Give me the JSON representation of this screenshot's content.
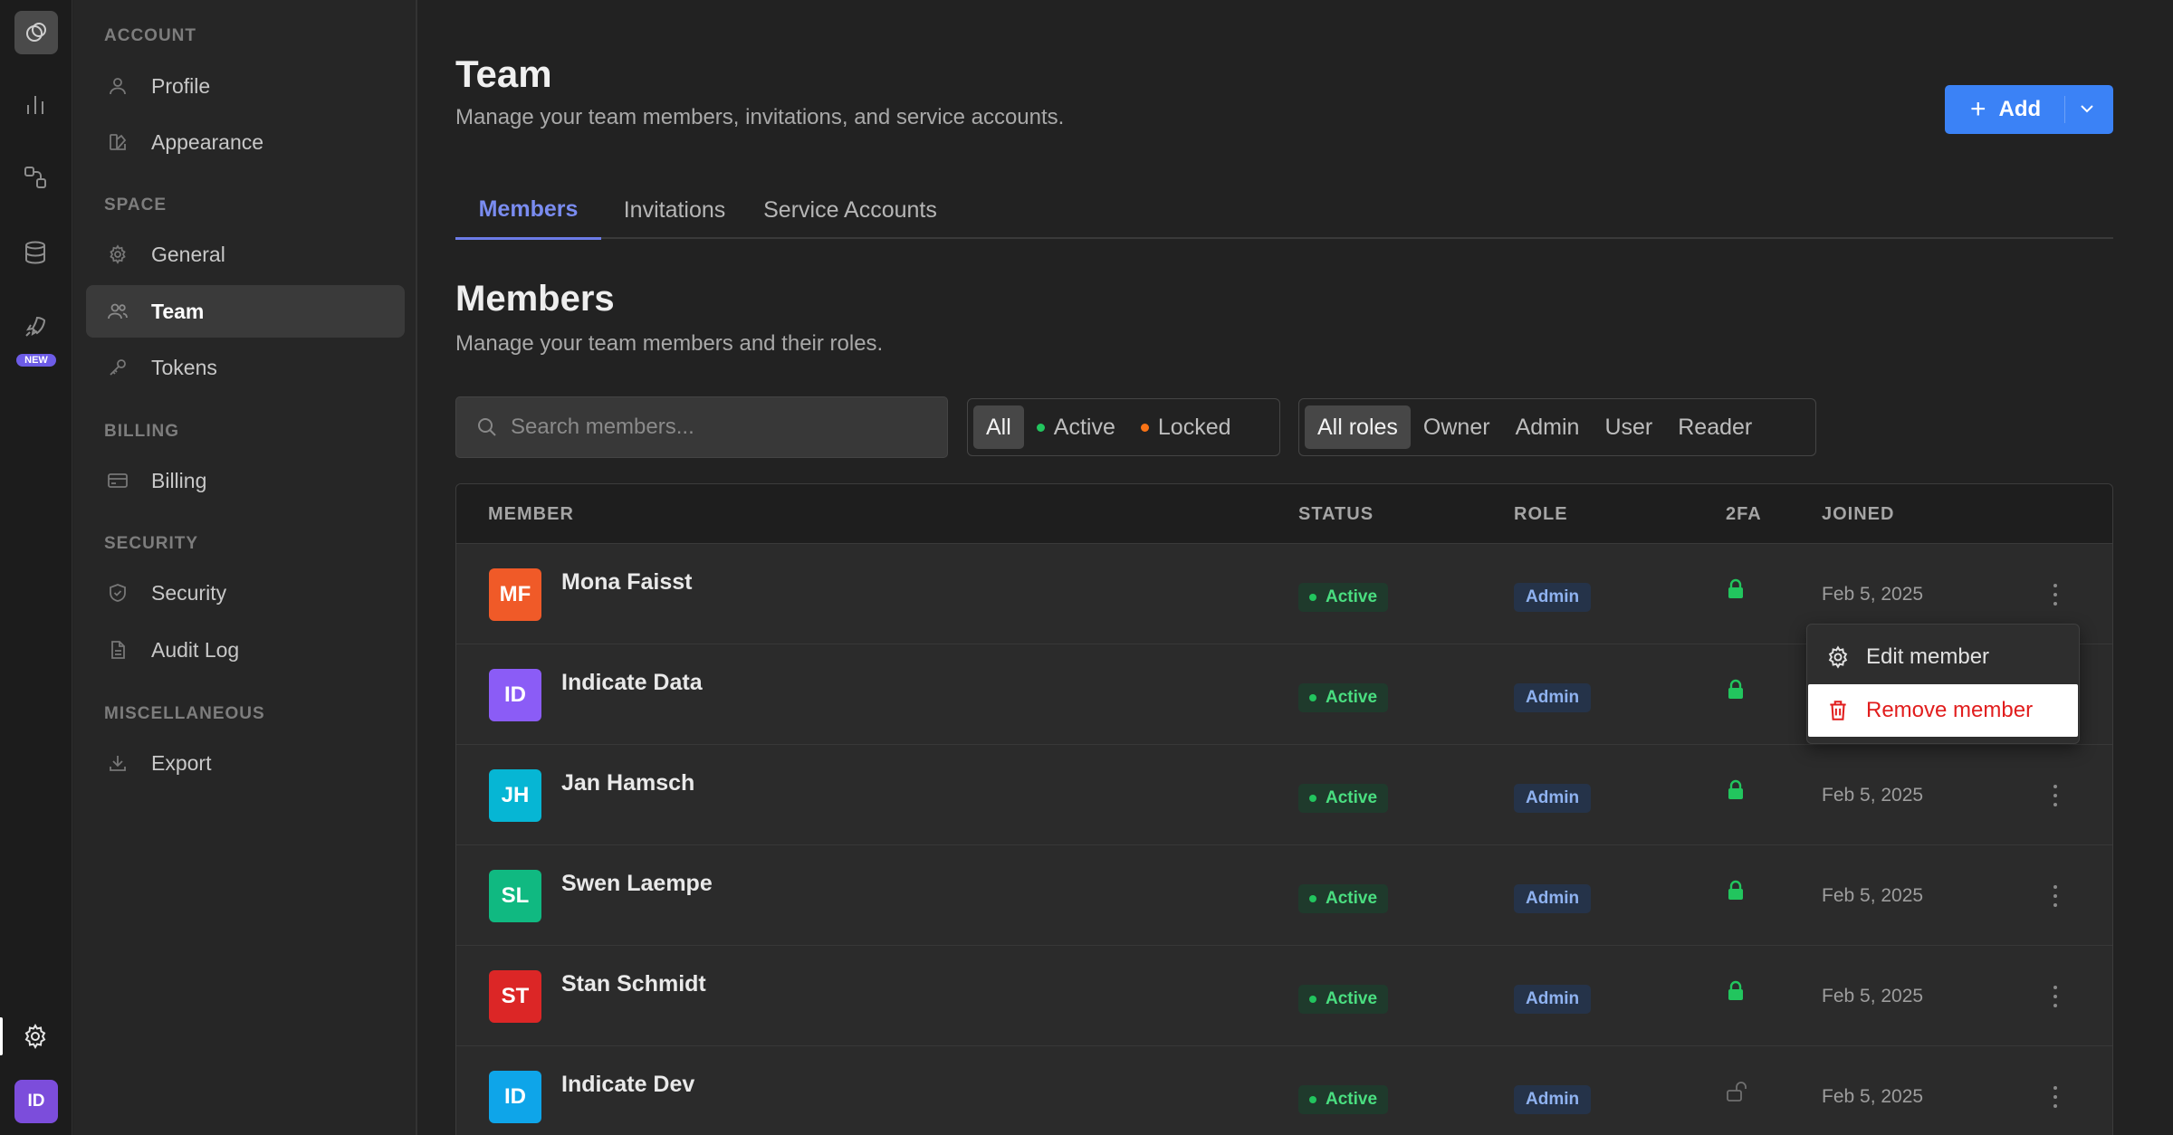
{
  "rail": {
    "new_badge": "NEW",
    "avatar": "ID",
    "icons": [
      "logo-icon",
      "analytics-icon",
      "integrations-icon",
      "database-icon",
      "rocket-icon",
      "settings-icon"
    ]
  },
  "sidebar": {
    "sections": [
      {
        "title": "ACCOUNT",
        "items": [
          "Profile",
          "Appearance"
        ]
      },
      {
        "title": "SPACE",
        "items": [
          "General",
          "Team",
          "Tokens"
        ]
      },
      {
        "title": "BILLING",
        "items": [
          "Billing"
        ]
      },
      {
        "title": "SECURITY",
        "items": [
          "Security",
          "Audit Log"
        ]
      },
      {
        "title": "MISCELLANEOUS",
        "items": [
          "Export"
        ]
      }
    ],
    "active_item": "Team"
  },
  "header": {
    "title": "Team",
    "subtitle": "Manage your team members, invitations, and service accounts.",
    "add_label": "Add"
  },
  "tabs": [
    "Members",
    "Invitations",
    "Service Accounts"
  ],
  "active_tab": "Members",
  "members_section": {
    "title": "Members",
    "subtitle": "Manage your team members and their roles.",
    "search_placeholder": "Search members...",
    "status_filters": [
      "All",
      "Active",
      "Locked"
    ],
    "role_filters": [
      "All roles",
      "Owner",
      "Admin",
      "User",
      "Reader"
    ]
  },
  "table": {
    "columns": [
      "MEMBER",
      "STATUS",
      "ROLE",
      "2FA",
      "JOINED"
    ],
    "rows": [
      {
        "initials": "MF",
        "name": "Mona Faisst",
        "status": "Active",
        "role": "Admin",
        "twofa": true,
        "joined": "Feb 5, 2025",
        "color": "#f05a28"
      },
      {
        "initials": "ID",
        "name": "Indicate Data",
        "status": "Active",
        "role": "Admin",
        "twofa": true,
        "joined": "",
        "color": "#8b5cf6"
      },
      {
        "initials": "JH",
        "name": "Jan Hamsch",
        "status": "Active",
        "role": "Admin",
        "twofa": true,
        "joined": "Feb 5, 2025",
        "color": "#06b6d4"
      },
      {
        "initials": "SL",
        "name": "Swen Laempe",
        "status": "Active",
        "role": "Admin",
        "twofa": true,
        "joined": "Feb 5, 2025",
        "color": "#10b981"
      },
      {
        "initials": "ST",
        "name": "Stan Schmidt",
        "status": "Active",
        "role": "Admin",
        "twofa": true,
        "joined": "Feb 5, 2025",
        "color": "#dc2626"
      },
      {
        "initials": "ID",
        "name": "Indicate Dev",
        "status": "Active",
        "role": "Admin",
        "twofa": false,
        "joined": "Feb 5, 2025",
        "color": "#0ea5e9"
      }
    ]
  },
  "context_menu": {
    "edit_label": "Edit member",
    "remove_label": "Remove member"
  },
  "colors": {
    "accent": "#3b82f6",
    "active_tab": "#7a8cf0",
    "status_active": "#22c55e",
    "status_locked": "#f97316",
    "danger": "#e11d1d"
  }
}
